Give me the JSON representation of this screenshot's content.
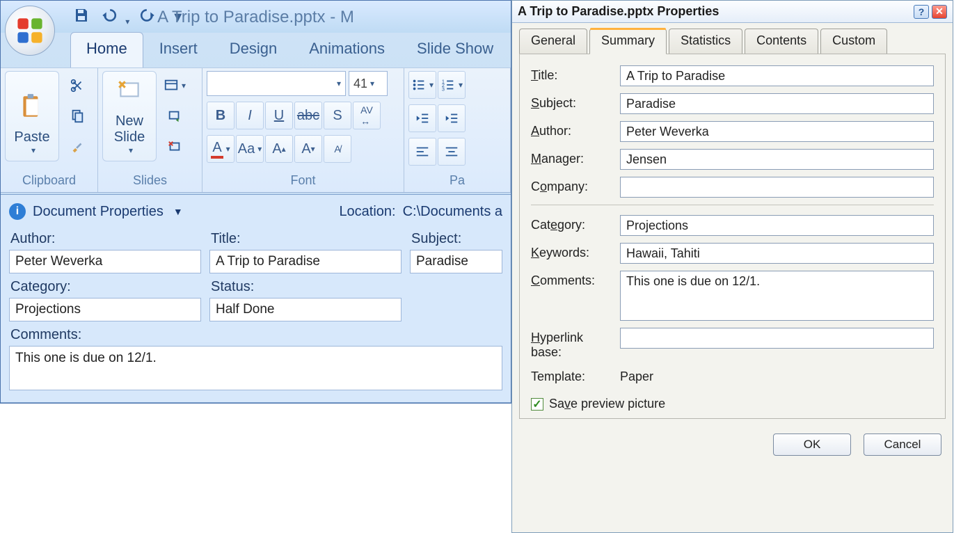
{
  "app": {
    "title": "A Trip to Paradise.pptx - M",
    "qat": {
      "save": "save-icon",
      "undo": "undo-icon",
      "redo": "redo-icon"
    }
  },
  "ribbon": {
    "tabs": [
      "Home",
      "Insert",
      "Design",
      "Animations",
      "Slide Show"
    ],
    "active": "Home",
    "groups": {
      "clipboard": {
        "label": "Clipboard",
        "paste": "Paste"
      },
      "slides": {
        "label": "Slides",
        "newSlide": "New\nSlide"
      },
      "font": {
        "label": "Font",
        "size": "41"
      },
      "paragraph": {
        "label": "Pa"
      }
    }
  },
  "docprops": {
    "header": "Document Properties",
    "locationLabel": "Location:",
    "locationValue": "C:\\Documents a",
    "fields": {
      "author": {
        "label": "Author:",
        "value": "Peter Weverka"
      },
      "title": {
        "label": "Title:",
        "value": "A Trip to Paradise"
      },
      "subject": {
        "label": "Subject:",
        "value": "Paradise"
      },
      "category": {
        "label": "Category:",
        "value": "Projections"
      },
      "status": {
        "label": "Status:",
        "value": "Half Done"
      },
      "comments": {
        "label": "Comments:",
        "value": "This one is due on 12/1."
      }
    }
  },
  "dialog": {
    "title": "A Trip to Paradise.pptx Properties",
    "tabs": [
      "General",
      "Summary",
      "Statistics",
      "Contents",
      "Custom"
    ],
    "active": "Summary",
    "fields": {
      "title": {
        "label": "Title:",
        "value": "A Trip to Paradise"
      },
      "subject": {
        "label": "Subject:",
        "value": "Paradise"
      },
      "author": {
        "label": "Author:",
        "value": "Peter Weverka"
      },
      "manager": {
        "label": "Manager:",
        "value": "Jensen"
      },
      "company": {
        "label": "Company:",
        "value": ""
      },
      "category": {
        "label": "Category:",
        "value": "Projections"
      },
      "keywords": {
        "label": "Keywords:",
        "value": "Hawaii, Tahiti"
      },
      "comments": {
        "label": "Comments:",
        "value": "This one is due on 12/1."
      },
      "hyperlink": {
        "label": "Hyperlink base:",
        "value": ""
      },
      "template": {
        "label": "Template:",
        "value": "Paper"
      }
    },
    "savePreview": {
      "label": "Save preview picture",
      "checked": true
    },
    "buttons": {
      "ok": "OK",
      "cancel": "Cancel"
    }
  }
}
